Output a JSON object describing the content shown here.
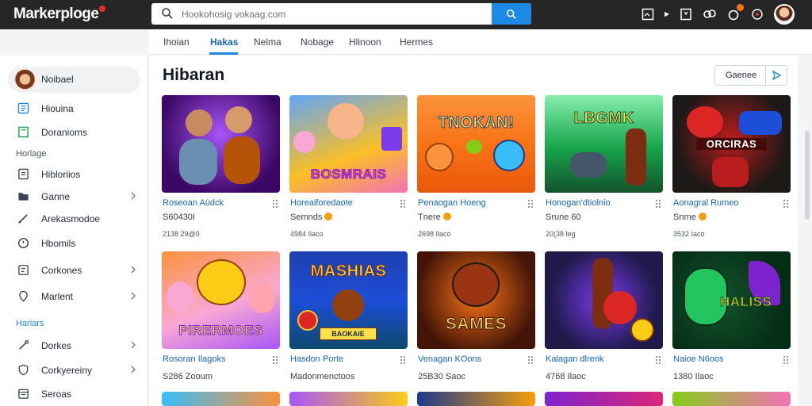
{
  "app": {
    "logo_text": "Markerploge"
  },
  "search": {
    "placeholder": "Hookohosig vokaag.com"
  },
  "tabs": [
    {
      "label": "Ihoian",
      "active": false
    },
    {
      "label": "Hakas",
      "active": true
    },
    {
      "label": "Nelma",
      "active": false
    },
    {
      "label": "Nobage",
      "active": false
    },
    {
      "label": "Hlinoon",
      "active": false
    },
    {
      "label": "Hermes",
      "active": false
    }
  ],
  "sidebar": {
    "profile_label": "Noibael",
    "items_top": [
      {
        "label": "Hiouina",
        "icon": "id-card-icon"
      },
      {
        "label": "Doranioms",
        "icon": "book-icon"
      }
    ],
    "group1": "Horlage",
    "items_mid": [
      {
        "label": "Hibloriios",
        "icon": "list-icon"
      },
      {
        "label": "Ganne",
        "icon": "folder-icon"
      },
      {
        "label": "Arekasmodoe",
        "icon": "pencil-icon"
      },
      {
        "label": "Hbomils",
        "icon": "clock-icon"
      },
      {
        "label": "Corkones",
        "icon": "doc-icon"
      },
      {
        "label": "Marlent",
        "icon": "pin-icon"
      }
    ],
    "group2": "Hariars",
    "items_bottom": [
      {
        "label": "Dorkes",
        "icon": "pen-icon"
      },
      {
        "label": "Corkyereiny",
        "icon": "shield-icon"
      },
      {
        "label": "Seroas",
        "icon": "calendar-icon"
      }
    ]
  },
  "main": {
    "title": "Hibaran",
    "filter_label": "Gaenee",
    "cards": [
      {
        "title": "Roseoan Aùdck",
        "meta": "S60430I",
        "meta2": "2138 29@0",
        "art": "",
        "coin": false
      },
      {
        "title": "Horeaiforedaote",
        "meta": "Semnds",
        "meta2": "4984 Ilaco",
        "art": "BOSMRAIS",
        "coin": true
      },
      {
        "title": "Penaogan Hoeng",
        "meta": "Tnere",
        "meta2": "2698 Ilaco",
        "art": "TNOKAN!",
        "coin": true
      },
      {
        "title": "Honogan'dtiolnio",
        "meta": "Srune 60",
        "meta2": "20(38 leg",
        "art": "LBGMK",
        "coin": false
      },
      {
        "title": "Aonagral Rumeo",
        "meta": "Snme",
        "meta2": "3532 Iaco",
        "art": "ORCIRAS",
        "coin": true
      },
      {
        "title": "Rosoran Ilagoks",
        "meta": "",
        "meta2": "S286 Zooum",
        "art": "PIRERMOES",
        "coin": false
      },
      {
        "title": "Hasdon Porte",
        "meta": "",
        "meta2": "Madonmenctoos",
        "art": "MASHIAS",
        "coin": false
      },
      {
        "title": "Venagan KOons",
        "meta": "",
        "meta2": "25B30 Saoc",
        "art": "SAMES",
        "coin": false
      },
      {
        "title": "Kalagan dlrenk",
        "meta": "",
        "meta2": "4768 Ilaoc",
        "art": "",
        "coin": false
      },
      {
        "title": "Naioe N6oos",
        "meta": "",
        "meta2": "1380 Ilaoc",
        "art": "HALISS",
        "coin": false
      }
    ]
  },
  "colors": {
    "accent": "#1e88e5",
    "topbar": "#262626",
    "link": "#1565c0"
  }
}
